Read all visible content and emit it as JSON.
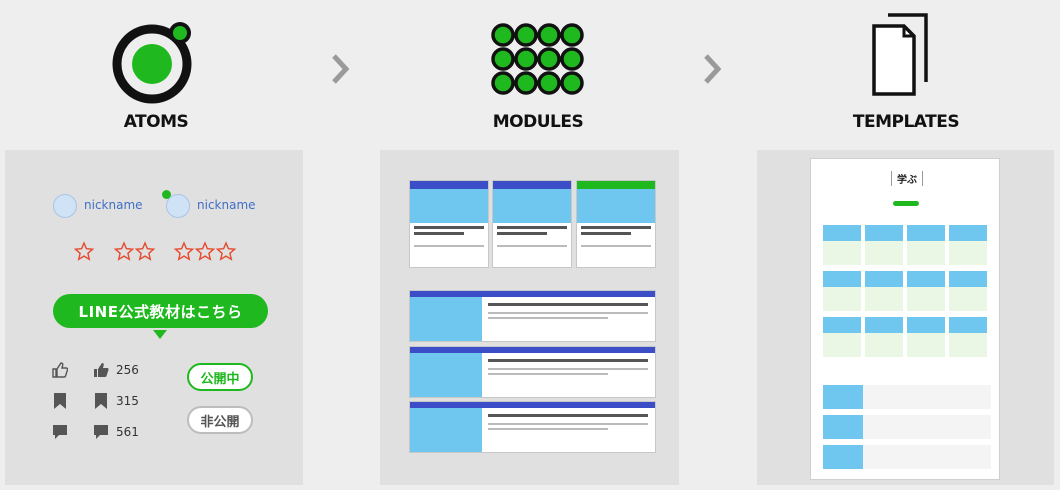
{
  "headings": {
    "atoms": "ATOMS",
    "modules": "MODULES",
    "templates": "TEMPLATES"
  },
  "atoms": {
    "nickname_1": "nickname",
    "nickname_2": "nickname",
    "line_button": "LINE公式教材はこちら",
    "stats": [
      "256",
      "315",
      "561"
    ],
    "public_label": "公開中",
    "private_label": "非公開",
    "rating_stars": [
      1,
      2,
      3
    ]
  },
  "colors": {
    "accent": "#1fb81f",
    "star": "#e64a2e",
    "card_bar": "#3c4ec7",
    "nickname": "#3f6fc6"
  },
  "icons": [
    "atom-ring-icon",
    "module-grid-icon",
    "documents-icon",
    "chevron-right-icon",
    "thumbs-up-icon",
    "bookmark-icon",
    "comment-icon",
    "star-icon"
  ],
  "templates": {
    "page_title": "学ぶ"
  }
}
